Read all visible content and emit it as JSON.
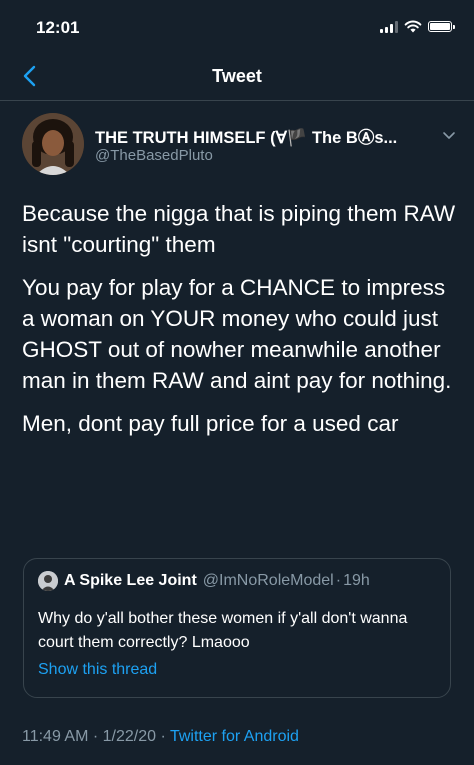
{
  "status_bar": {
    "time": "12:01"
  },
  "nav": {
    "title": "Tweet"
  },
  "author": {
    "name": "THE TRUTH HIMSELF (∀🏴 The BⒶs...",
    "handle": "@TheBasedPluto"
  },
  "tweet": {
    "paragraphs": [
      "Because the nigga that is piping them RAW isnt \"courting\" them",
      "You pay for play for a CHANCE to impress a woman on YOUR money who could just GHOST out of nowher meanwhile another man in them RAW and aint pay for nothing.",
      "Men, dont pay full price for a used car"
    ]
  },
  "quote": {
    "name": "A Spike Lee Joint",
    "handle": "@ImNoRoleModel",
    "separator": "·",
    "time": "19h",
    "text": "Why do y'all bother these women if y'all don't wanna court them correctly? Lmaooo",
    "thread_link": "Show this thread"
  },
  "meta": {
    "time": "11:49 AM",
    "sep1": "·",
    "date": "1/22/20",
    "sep2": "·",
    "source": "Twitter for Android"
  },
  "colors": {
    "background": "#15202b",
    "accent": "#1da1f2",
    "secondary_text": "#8899a6",
    "divider": "#38444d"
  },
  "icons": [
    "back-chevron-icon",
    "cellular-signal-icon",
    "wifi-icon",
    "battery-icon",
    "dropdown-caret-icon"
  ]
}
